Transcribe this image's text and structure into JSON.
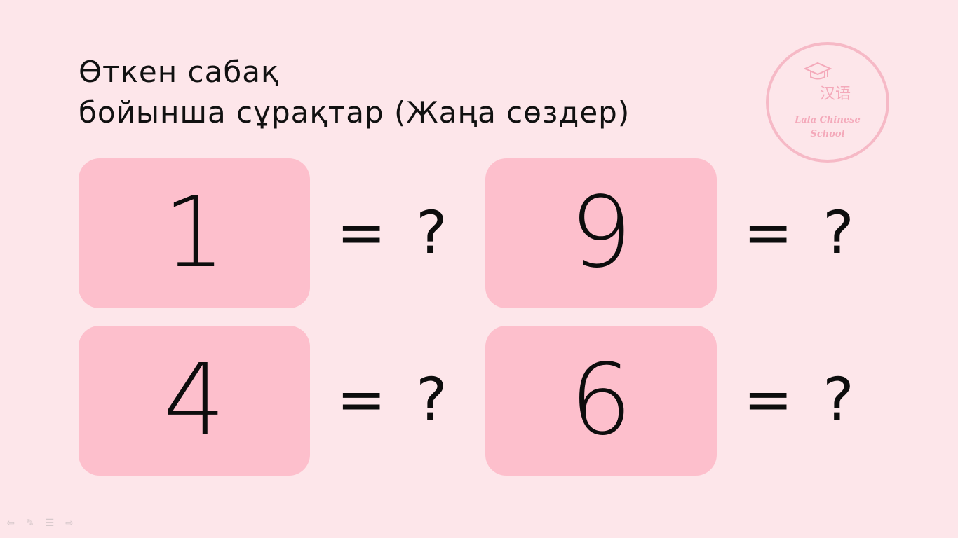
{
  "title": {
    "line1": "Өткен сабақ",
    "line2": "бойынша сұрақтар (Жаңа сөздер)"
  },
  "logo": {
    "hanzi": "汉语",
    "name_line1": "Lala Chinese",
    "name_line2": "School",
    "icon": "graduation-cap-icon",
    "color": "#f4a9ba"
  },
  "cards": [
    {
      "number": "1",
      "suffix": "= ?"
    },
    {
      "number": "9",
      "suffix": "= ?"
    },
    {
      "number": "4",
      "suffix": "= ?"
    },
    {
      "number": "6",
      "suffix": "= ?"
    }
  ],
  "toolbar": [
    {
      "icon": "arrow-left-icon"
    },
    {
      "icon": "pen-icon"
    },
    {
      "icon": "menu-icon"
    },
    {
      "icon": "arrow-right-icon"
    }
  ],
  "colors": {
    "background": "#fde6ea",
    "card": "#fdbfcc",
    "text": "#0d0d0d"
  }
}
